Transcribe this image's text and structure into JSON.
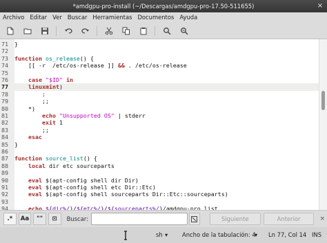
{
  "window": {
    "title": "*amdgpu-pro-install (~/Descargas/amdgpu-pro-17.50-511655)",
    "close_glyph": "×"
  },
  "menu": [
    "Archivo",
    "Editar",
    "Ver",
    "Buscar",
    "Herramientas",
    "Documentos",
    "Ayuda"
  ],
  "toolbar": [
    {
      "icon": "new-document-icon"
    },
    {
      "icon": "open-folder-icon"
    },
    {
      "icon": "save-icon"
    },
    {
      "icon": "undo-icon"
    },
    {
      "icon": "redo-icon"
    },
    {
      "icon": "cut-icon"
    },
    {
      "icon": "copy-icon"
    },
    {
      "icon": "paste-icon"
    },
    {
      "icon": "search-icon"
    },
    {
      "icon": "replace-icon"
    }
  ],
  "editor": {
    "current_line": 77,
    "lines": [
      {
        "n": "71",
        "text": "}"
      },
      {
        "n": "72",
        "text": ""
      },
      {
        "n": "73",
        "text": "function os_release() {"
      },
      {
        "n": "74",
        "text": "    [[ -r  /etc/os-release ]] && . /etc/os-release"
      },
      {
        "n": "75",
        "text": ""
      },
      {
        "n": "76",
        "text": "    case \"$ID\" in"
      },
      {
        "n": "77",
        "text": "    linuxmint)"
      },
      {
        "n": "78",
        "text": "        :"
      },
      {
        "n": "79",
        "text": "        ;;"
      },
      {
        "n": "80",
        "text": "    *)"
      },
      {
        "n": "81",
        "text": "        echo \"Unsupported OS\" | stderr"
      },
      {
        "n": "82",
        "text": "        exit 1"
      },
      {
        "n": "83",
        "text": "        ;;"
      },
      {
        "n": "84",
        "text": "    esac"
      },
      {
        "n": "85",
        "text": "}"
      },
      {
        "n": "86",
        "text": ""
      },
      {
        "n": "87",
        "text": "function source_list() {"
      },
      {
        "n": "88",
        "text": "    local dir etc sourceparts"
      },
      {
        "n": "89",
        "text": ""
      },
      {
        "n": "90",
        "text": "    eval $(apt-config shell dir Dir)"
      },
      {
        "n": "91",
        "text": "    eval $(apt-config shell etc Dir::Etc)"
      },
      {
        "n": "92",
        "text": "    eval $(apt-config shell sourceparts Dir::Etc::sourceparts)"
      },
      {
        "n": "93",
        "text": ""
      },
      {
        "n": "94",
        "text": "    echo ${dir%/}/${etc%/}/${sourceparts%/}/amdgpu-pro.list"
      }
    ]
  },
  "search": {
    "toggles": [
      ".*",
      "Aa",
      "\"\"",
      "⊡"
    ],
    "label": "Buscar:",
    "placeholder": "",
    "value": "",
    "next_label": "Siguiente",
    "prev_label": "Anterior",
    "close_glyph": "×"
  },
  "status": {
    "language": "sh",
    "tab_width": "Ancho de la tabulación: 4",
    "position": "Ln 77, Col 14",
    "mode": "INS"
  },
  "colors": {
    "keyword": "#a52a2a",
    "function_name": "#008b8b",
    "string": "#c000c0",
    "variable": "#6a0dad"
  }
}
